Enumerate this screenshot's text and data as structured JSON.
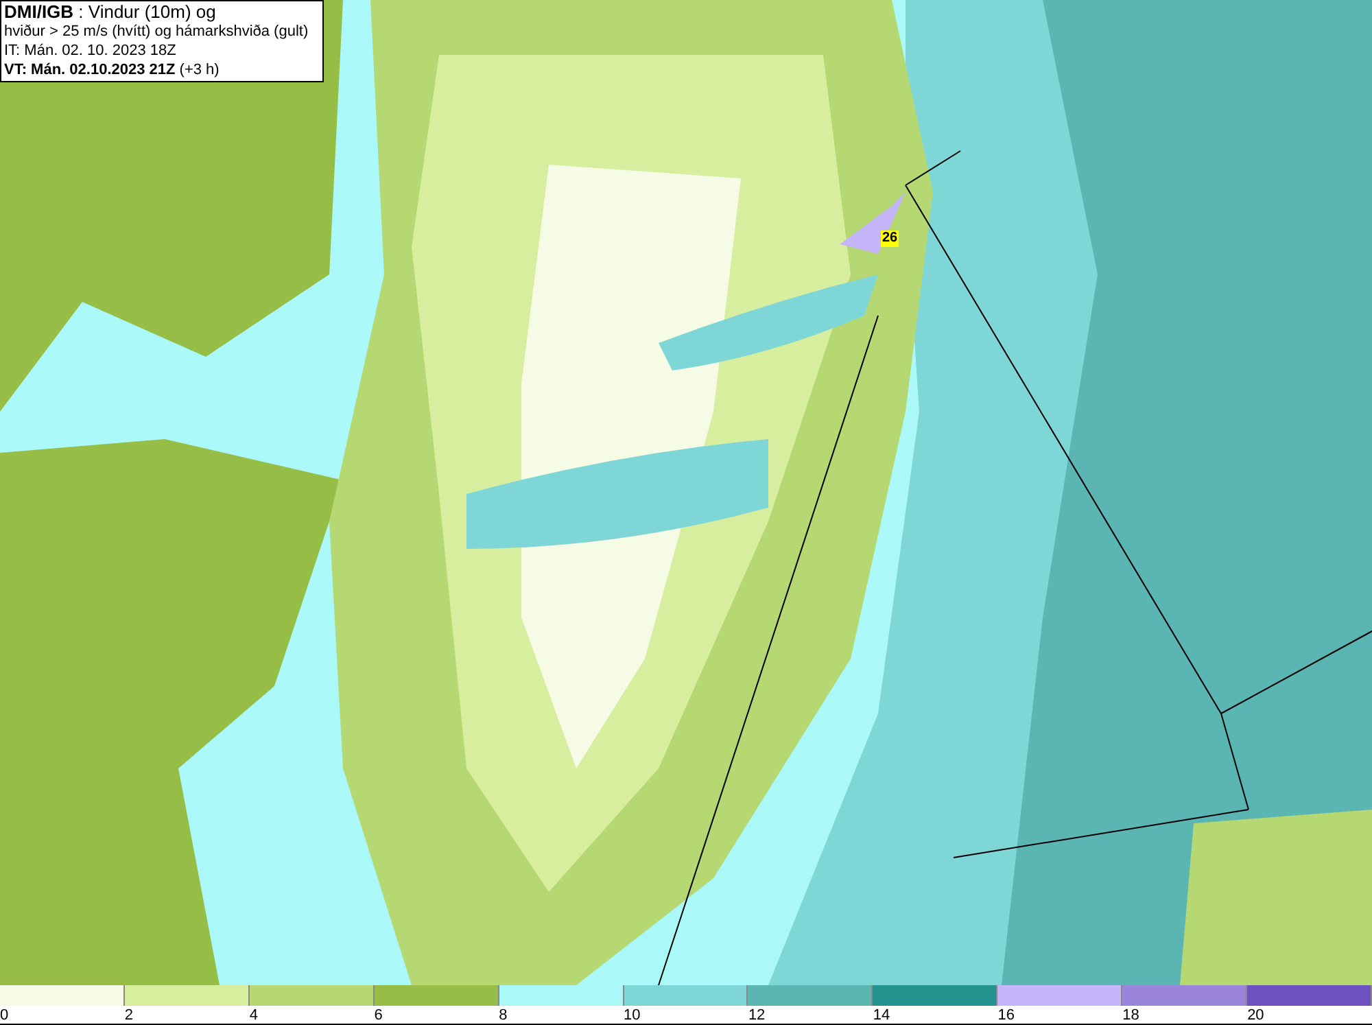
{
  "title_box": {
    "lines": [
      "**DMI/IGB** : Vindur (10m) og",
      "hviður > 25 m/s (hvítt) og hámarkshviða (gult)",
      "IT: Mán. 02. 10. 2023 18Z",
      "**VT: Mán. 02.10.2023 21Z** (+3 h)"
    ]
  },
  "map": {
    "gust_marker": "26"
  },
  "legend": {
    "segments": [
      {
        "color": "#f5fbe4"
      },
      {
        "color": "#d7ee9f"
      },
      {
        "color": "#b5d872"
      },
      {
        "color": "#96bd45"
      },
      {
        "color": "#aaf8f8"
      },
      {
        "color": "#7fd6d6"
      },
      {
        "color": "#5bb5b2"
      },
      {
        "color": "#249490"
      },
      {
        "color": "#c4b6f8"
      },
      {
        "color": "#9a84dc"
      },
      {
        "color": "#6e50bf"
      }
    ],
    "ticks": [
      "0",
      "2",
      "4",
      "6",
      "8",
      "10",
      "12",
      "14",
      "16",
      "18",
      "20"
    ]
  }
}
